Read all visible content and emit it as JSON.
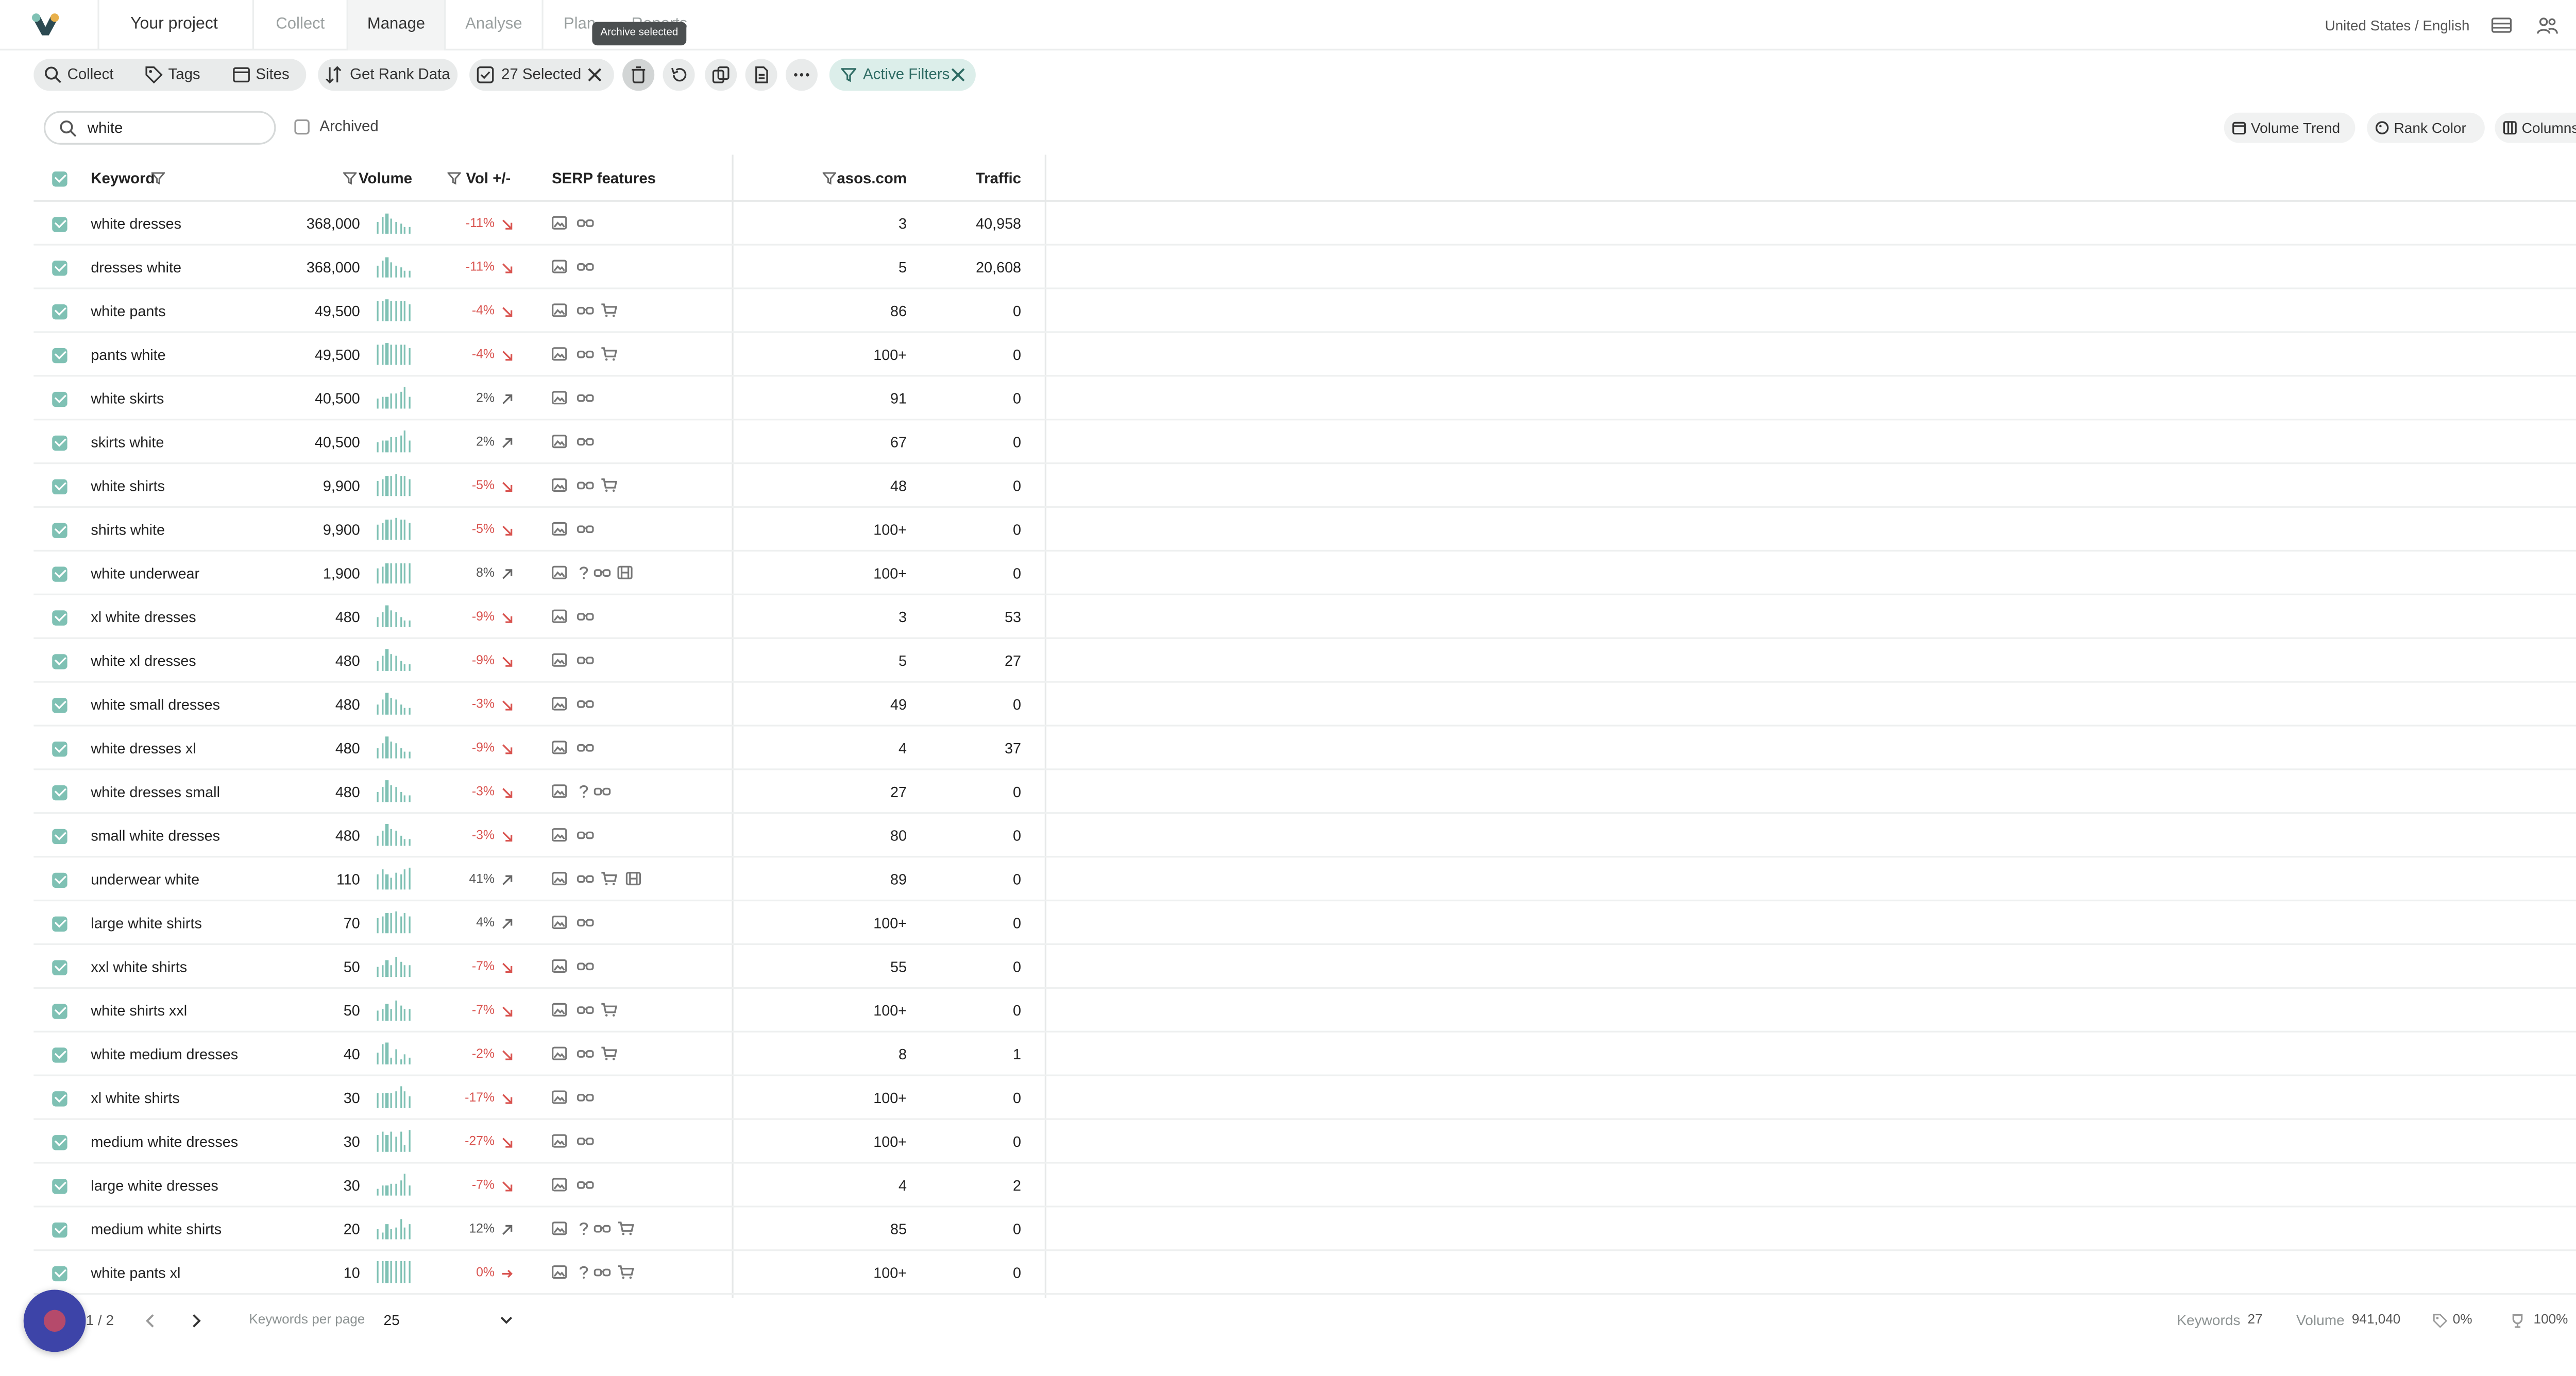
{
  "nav": {
    "project": "Your project",
    "tabs": [
      "Collect",
      "Manage",
      "Analyse",
      "Plan",
      "Reports"
    ],
    "active_tab": "Manage",
    "tooltip": "Archive selected",
    "locale": "United States / English"
  },
  "toolbar": {
    "collect": "Collect",
    "tags": "Tags",
    "sites": "Sites",
    "rank": "Get Rank Data",
    "selected": "27 Selected",
    "active_filters": "Active Filters"
  },
  "panel": {
    "search_value": "white",
    "archived_label": "Archived",
    "volume_trend": "Volume Trend",
    "rank_color": "Rank Color",
    "columns": "Columns"
  },
  "table": {
    "headers": {
      "keyword": "Keyword",
      "volume": "Volume",
      "vol_change": "Vol +/-",
      "serp": "SERP features",
      "site": "asos.com",
      "traffic": "Traffic"
    },
    "rows": [
      {
        "keyword": "white dresses",
        "volume": "368,000",
        "trend": [
          5,
          7,
          8,
          6,
          5,
          4,
          3,
          3
        ],
        "change": "-11%",
        "dir": "down",
        "serp": [
          "image",
          "glasses"
        ],
        "rank": "3",
        "traffic": "40,958"
      },
      {
        "keyword": "dresses white",
        "volume": "368,000",
        "trend": [
          5,
          7,
          8,
          6,
          5,
          4,
          3,
          3
        ],
        "change": "-11%",
        "dir": "down",
        "serp": [
          "image",
          "glasses"
        ],
        "rank": "5",
        "traffic": "20,608"
      },
      {
        "keyword": "white pants",
        "volume": "49,500",
        "trend": [
          8,
          8,
          9,
          8,
          8,
          8,
          8,
          7
        ],
        "change": "-4%",
        "dir": "down",
        "serp": [
          "image",
          "glasses",
          "cart"
        ],
        "rank": "86",
        "traffic": "0"
      },
      {
        "keyword": "pants white",
        "volume": "49,500",
        "trend": [
          8,
          8,
          9,
          8,
          8,
          8,
          8,
          7
        ],
        "change": "-4%",
        "dir": "down",
        "serp": [
          "image",
          "glasses",
          "cart"
        ],
        "rank": "100+",
        "traffic": "0"
      },
      {
        "keyword": "white skirts",
        "volume": "40,500",
        "trend": [
          4,
          5,
          5,
          6,
          6,
          7,
          9,
          5
        ],
        "change": "2%",
        "dir": "up",
        "serp": [
          "image",
          "glasses"
        ],
        "rank": "91",
        "traffic": "0"
      },
      {
        "keyword": "skirts white",
        "volume": "40,500",
        "trend": [
          4,
          5,
          5,
          6,
          6,
          7,
          9,
          5
        ],
        "change": "2%",
        "dir": "up",
        "serp": [
          "image",
          "glasses"
        ],
        "rank": "67",
        "traffic": "0"
      },
      {
        "keyword": "white shirts",
        "volume": "9,900",
        "trend": [
          6,
          7,
          8,
          8,
          9,
          8,
          8,
          7
        ],
        "change": "-5%",
        "dir": "down",
        "serp": [
          "image",
          "glasses",
          "cart"
        ],
        "rank": "48",
        "traffic": "0"
      },
      {
        "keyword": "shirts white",
        "volume": "9,900",
        "trend": [
          6,
          7,
          8,
          8,
          9,
          8,
          8,
          7
        ],
        "change": "-5%",
        "dir": "down",
        "serp": [
          "image",
          "glasses"
        ],
        "rank": "100+",
        "traffic": "0"
      },
      {
        "keyword": "white underwear",
        "volume": "1,900",
        "trend": [
          6,
          7,
          8,
          8,
          8,
          8,
          8,
          8
        ],
        "change": "8%",
        "dir": "up",
        "serp": [
          "image",
          "question",
          "glasses",
          "video"
        ],
        "rank": "100+",
        "traffic": "0"
      },
      {
        "keyword": "xl white dresses",
        "volume": "480",
        "trend": [
          4,
          6,
          9,
          7,
          6,
          4,
          3,
          3
        ],
        "change": "-9%",
        "dir": "down",
        "serp": [
          "image",
          "glasses"
        ],
        "rank": "3",
        "traffic": "53"
      },
      {
        "keyword": "white xl dresses",
        "volume": "480",
        "trend": [
          4,
          6,
          9,
          7,
          6,
          4,
          3,
          3
        ],
        "change": "-9%",
        "dir": "down",
        "serp": [
          "image",
          "glasses"
        ],
        "rank": "5",
        "traffic": "27"
      },
      {
        "keyword": "white small dresses",
        "volume": "480",
        "trend": [
          4,
          6,
          9,
          7,
          6,
          4,
          3,
          3
        ],
        "change": "-3%",
        "dir": "down",
        "serp": [
          "image",
          "glasses"
        ],
        "rank": "49",
        "traffic": "0"
      },
      {
        "keyword": "white dresses xl",
        "volume": "480",
        "trend": [
          4,
          6,
          9,
          7,
          6,
          4,
          3,
          3
        ],
        "change": "-9%",
        "dir": "down",
        "serp": [
          "image",
          "glasses"
        ],
        "rank": "4",
        "traffic": "37"
      },
      {
        "keyword": "white dresses small",
        "volume": "480",
        "trend": [
          4,
          6,
          9,
          7,
          6,
          4,
          3,
          3
        ],
        "change": "-3%",
        "dir": "down",
        "serp": [
          "image",
          "question",
          "glasses"
        ],
        "rank": "27",
        "traffic": "0"
      },
      {
        "keyword": "small white dresses",
        "volume": "480",
        "trend": [
          4,
          6,
          9,
          7,
          6,
          4,
          3,
          3
        ],
        "change": "-3%",
        "dir": "down",
        "serp": [
          "image",
          "glasses"
        ],
        "rank": "80",
        "traffic": "0"
      },
      {
        "keyword": "underwear white",
        "volume": "110",
        "trend": [
          6,
          8,
          6,
          5,
          7,
          6,
          8,
          9
        ],
        "change": "41%",
        "dir": "up",
        "serp": [
          "image",
          "glasses",
          "cart",
          "video"
        ],
        "rank": "89",
        "traffic": "0"
      },
      {
        "keyword": "large white shirts",
        "volume": "70",
        "trend": [
          6,
          7,
          8,
          8,
          9,
          7,
          8,
          7
        ],
        "change": "4%",
        "dir": "up",
        "serp": [
          "image",
          "glasses"
        ],
        "rank": "100+",
        "traffic": "0"
      },
      {
        "keyword": "xxl white shirts",
        "volume": "50",
        "trend": [
          4,
          5,
          7,
          5,
          8,
          6,
          5,
          5
        ],
        "change": "-7%",
        "dir": "down",
        "serp": [
          "image",
          "glasses"
        ],
        "rank": "55",
        "traffic": "0"
      },
      {
        "keyword": "white shirts xxl",
        "volume": "50",
        "trend": [
          4,
          5,
          7,
          5,
          8,
          6,
          5,
          5
        ],
        "change": "-7%",
        "dir": "down",
        "serp": [
          "image",
          "glasses",
          "cart"
        ],
        "rank": "100+",
        "traffic": "0"
      },
      {
        "keyword": "white medium dresses",
        "volume": "40",
        "trend": [
          5,
          8,
          9,
          3,
          6,
          2,
          4,
          3
        ],
        "change": "-2%",
        "dir": "down",
        "serp": [
          "image",
          "glasses",
          "cart"
        ],
        "rank": "8",
        "traffic": "1"
      },
      {
        "keyword": "xl white shirts",
        "volume": "30",
        "trend": [
          6,
          6,
          6,
          6,
          7,
          9,
          7,
          5
        ],
        "change": "-17%",
        "dir": "down",
        "serp": [
          "image",
          "glasses"
        ],
        "rank": "100+",
        "traffic": "0"
      },
      {
        "keyword": "medium white dresses",
        "volume": "30",
        "trend": [
          7,
          8,
          7,
          8,
          6,
          8,
          3,
          9
        ],
        "change": "-27%",
        "dir": "down",
        "serp": [
          "image",
          "glasses"
        ],
        "rank": "100+",
        "traffic": "0"
      },
      {
        "keyword": "large white dresses",
        "volume": "30",
        "trend": [
          3,
          4,
          4,
          5,
          5,
          6,
          9,
          4
        ],
        "change": "-7%",
        "dir": "down",
        "serp": [
          "image",
          "glasses"
        ],
        "rank": "4",
        "traffic": "2"
      },
      {
        "keyword": "medium white shirts",
        "volume": "20",
        "trend": [
          4,
          3,
          6,
          4,
          5,
          8,
          5,
          6
        ],
        "change": "12%",
        "dir": "up",
        "serp": [
          "image",
          "question",
          "glasses",
          "cart"
        ],
        "rank": "85",
        "traffic": "0"
      },
      {
        "keyword": "white pants xl",
        "volume": "10",
        "trend": [
          9,
          9,
          9,
          9,
          9,
          9,
          9,
          9
        ],
        "change": "0%",
        "dir": "flat",
        "serp": [
          "image",
          "question",
          "glasses",
          "cart"
        ],
        "rank": "100+",
        "traffic": "0"
      }
    ]
  },
  "footer": {
    "page": "1 / 2",
    "per_page_label": "Keywords per page",
    "per_page_value": "25",
    "keywords_label": "Keywords",
    "keywords_value": "27",
    "volume_label": "Volume",
    "volume_value": "941,040",
    "tag_pct": "0%",
    "trophy_pct": "100%"
  },
  "colors": {
    "accent": "#7fc1b4",
    "negative": "#d9534f",
    "filter_bg": "#dceeea",
    "fab": "#3d44a8"
  }
}
